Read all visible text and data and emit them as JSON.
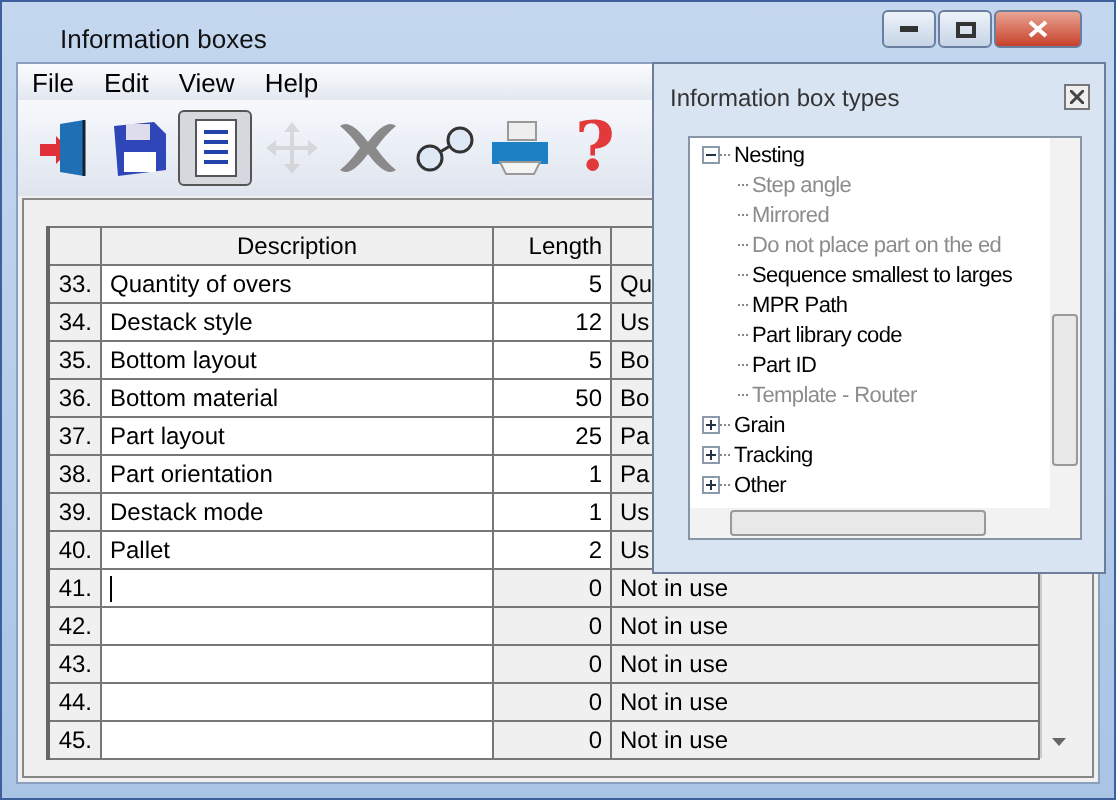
{
  "window": {
    "title": "Information boxes"
  },
  "menu": [
    "File",
    "Edit",
    "View",
    "Help"
  ],
  "toolbar": [
    {
      "kind": "exit",
      "selected": false,
      "disabled": false
    },
    {
      "kind": "save",
      "selected": false,
      "disabled": false
    },
    {
      "kind": "list",
      "selected": true,
      "disabled": false
    },
    {
      "kind": "move",
      "selected": false,
      "disabled": true
    },
    {
      "kind": "delete",
      "selected": false,
      "disabled": false
    },
    {
      "kind": "view",
      "selected": false,
      "disabled": false
    },
    {
      "kind": "print",
      "selected": false,
      "disabled": false
    },
    {
      "kind": "help",
      "label": "?",
      "selected": false,
      "disabled": false
    }
  ],
  "table": {
    "columns": [
      "Description",
      "Length"
    ],
    "rows": [
      {
        "number": "33.",
        "description": "Quantity of overs",
        "length": "5",
        "column_3": "Qu",
        "disabled": false,
        "focused": false
      },
      {
        "number": "34.",
        "description": "Destack style",
        "length": "12",
        "column_3": "Us",
        "disabled": false,
        "focused": false
      },
      {
        "number": "35.",
        "description": "Bottom layout",
        "length": "5",
        "column_3": "Bo",
        "disabled": false,
        "focused": false
      },
      {
        "number": "36.",
        "description": "Bottom material",
        "length": "50",
        "column_3": "Bo",
        "disabled": false,
        "focused": false
      },
      {
        "number": "37.",
        "description": "Part layout",
        "length": "25",
        "column_3": "Pa",
        "disabled": false,
        "focused": false
      },
      {
        "number": "38.",
        "description": "Part orientation",
        "length": "1",
        "column_3": "Pa",
        "disabled": false,
        "focused": false
      },
      {
        "number": "39.",
        "description": "Destack mode",
        "length": "1",
        "column_3": "Us",
        "disabled": false,
        "focused": false
      },
      {
        "number": "40.",
        "description": "Pallet",
        "length": "2",
        "column_3": "Us",
        "disabled": false,
        "focused": false
      },
      {
        "number": "41.",
        "description": "",
        "length": "0",
        "column_3": "Not in use",
        "disabled": true,
        "focused": true
      },
      {
        "number": "42.",
        "description": "",
        "length": "0",
        "column_3": "Not in use",
        "disabled": true,
        "focused": false
      },
      {
        "number": "43.",
        "description": "",
        "length": "0",
        "column_3": "Not in use",
        "disabled": true,
        "focused": false
      },
      {
        "number": "44.",
        "description": "",
        "length": "0",
        "column_3": "Not in use",
        "disabled": true,
        "focused": false
      },
      {
        "number": "45.",
        "description": "",
        "length": "0",
        "column_3": "Not in use",
        "disabled": true,
        "focused": false
      }
    ]
  },
  "panel": {
    "title": "Information box types",
    "tree": [
      {
        "label": "Nesting",
        "expanded": true,
        "disabled": false,
        "children": [
          {
            "label": "Step angle",
            "disabled": true
          },
          {
            "label": "Mirrored",
            "disabled": true
          },
          {
            "label": "Do not place part on the ed",
            "disabled": true
          },
          {
            "label": "Sequence smallest to larges",
            "disabled": false
          },
          {
            "label": "MPR Path",
            "disabled": false
          },
          {
            "label": "Part library code",
            "disabled": false
          },
          {
            "label": "Part ID",
            "disabled": false
          },
          {
            "label": "Template - Router",
            "disabled": true
          }
        ]
      },
      {
        "label": "Grain",
        "expanded": false,
        "disabled": false
      },
      {
        "label": "Tracking",
        "expanded": false,
        "disabled": false
      },
      {
        "label": "Other",
        "expanded": false,
        "disabled": false
      }
    ]
  }
}
